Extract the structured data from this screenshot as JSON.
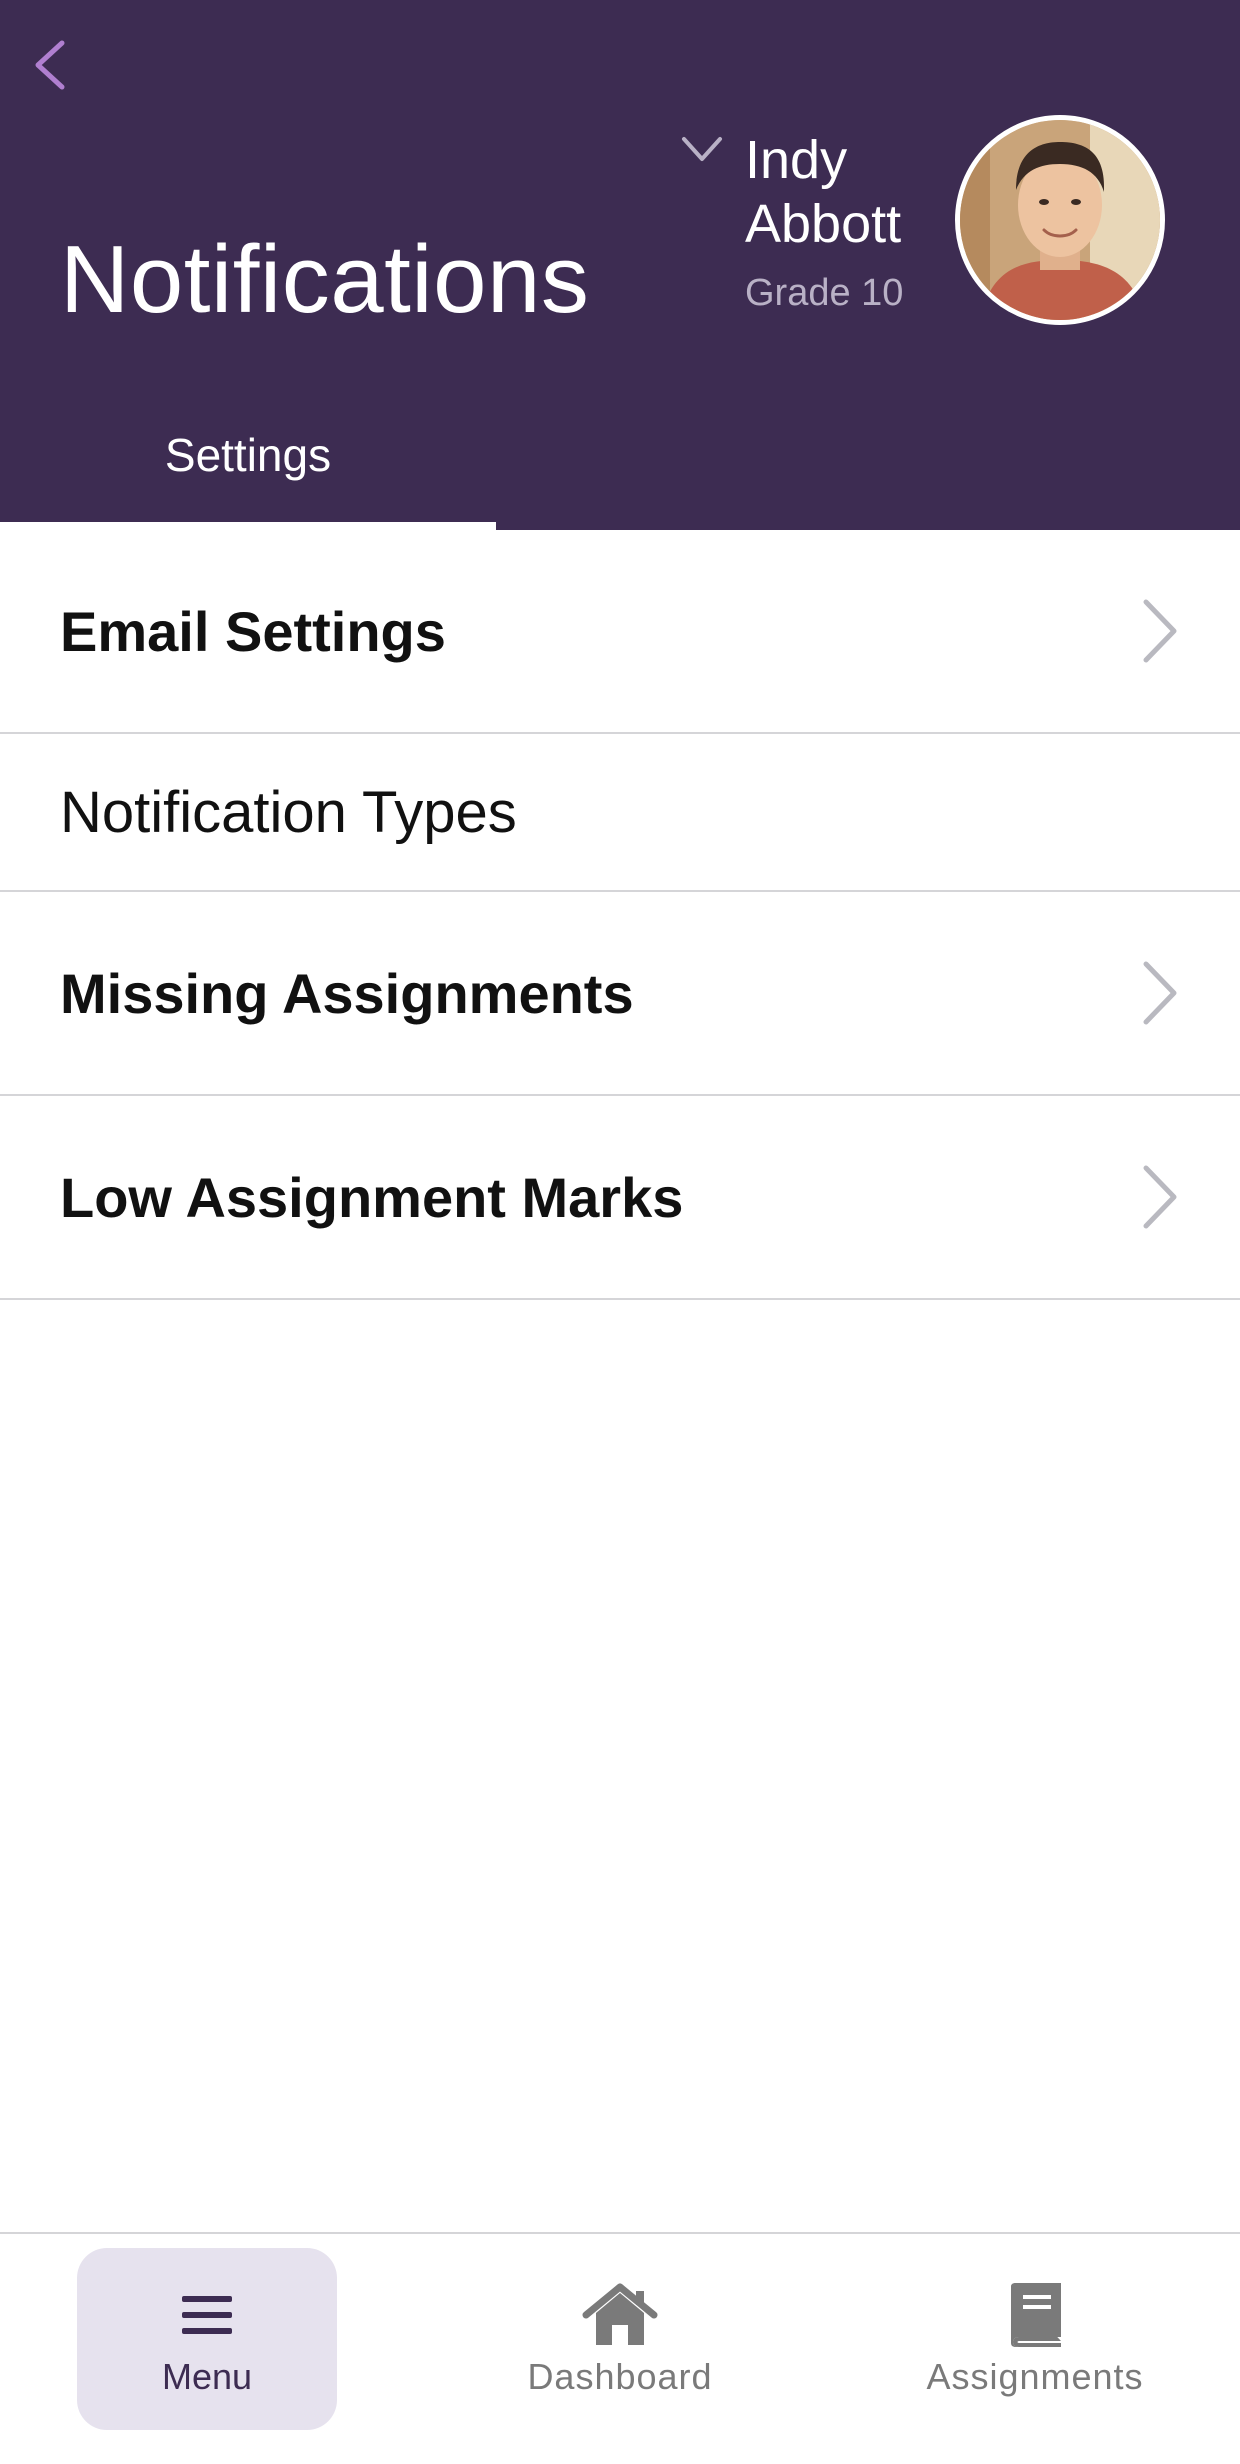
{
  "header": {
    "title": "Notifications",
    "back_icon": "chevron-left-icon"
  },
  "student": {
    "first_name": "Indy",
    "last_name": "Abbott",
    "grade": "Grade 10",
    "switch_icon": "chevron-down-icon"
  },
  "tabs": [
    {
      "label": "Settings",
      "active": true
    }
  ],
  "list": {
    "email_settings": "Email Settings",
    "section_notification_types": "Notification Types",
    "missing_assignments": "Missing Assignments",
    "low_assignment_marks": "Low Assignment Marks"
  },
  "bottom_nav": {
    "items": [
      {
        "label": "Menu",
        "icon": "hamburger-menu-icon",
        "active": true
      },
      {
        "label": "Dashboard",
        "icon": "home-icon",
        "active": false
      },
      {
        "label": "Assignments",
        "icon": "book-icon",
        "active": false
      }
    ]
  },
  "colors": {
    "header_bg": "#3d2c52",
    "accent_light": "#b07fd0",
    "active_nav_bg": "#e6e2ee",
    "divider": "#d5d5d8",
    "chevron": "#b9b9c0"
  }
}
